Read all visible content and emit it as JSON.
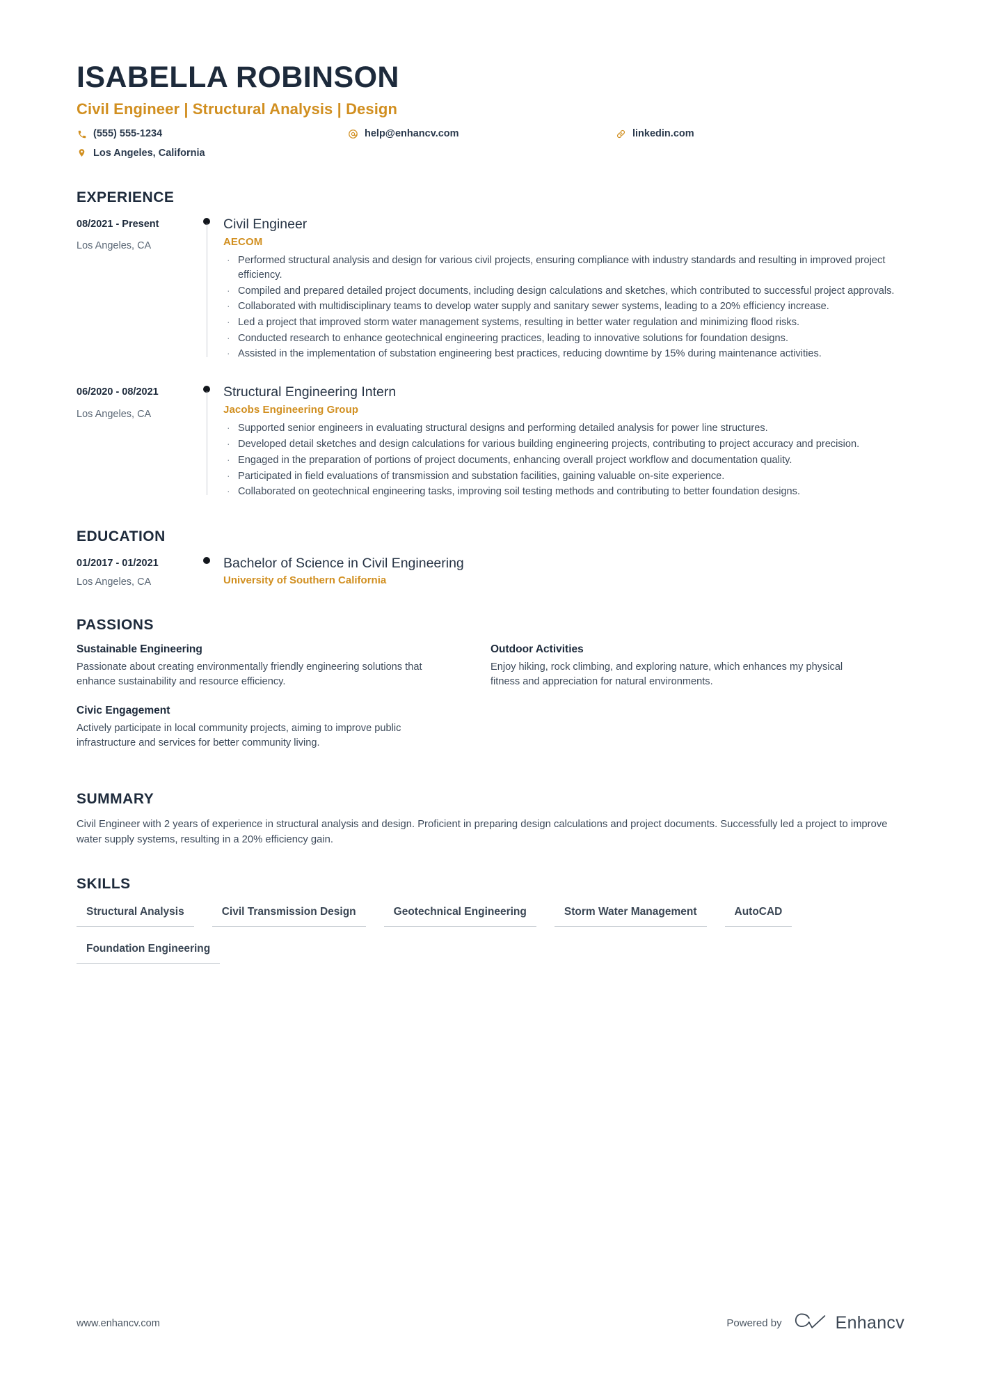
{
  "header": {
    "name": "ISABELLA ROBINSON",
    "headline": "Civil Engineer | Structural Analysis | Design",
    "contacts": [
      {
        "icon": "phone-icon",
        "text": "(555) 555-1234"
      },
      {
        "icon": "location-icon",
        "text": "Los Angeles, California"
      },
      {
        "icon": "email-icon",
        "text": "help@enhancv.com"
      },
      {
        "icon": "link-icon",
        "text": "linkedin.com"
      }
    ]
  },
  "experience": {
    "title": "EXPERIENCE",
    "entries": [
      {
        "date": "08/2021 - Present",
        "location": "Los Angeles, CA",
        "role": "Civil Engineer",
        "company": "AECOM",
        "bullets": [
          "Performed structural analysis and design for various civil projects, ensuring compliance with industry standards and resulting in improved project efficiency.",
          "Compiled and prepared detailed project documents, including design calculations and sketches, which contributed to successful project approvals.",
          "Collaborated with multidisciplinary teams to develop water supply and sanitary sewer systems, leading to a 20% efficiency increase.",
          "Led a project that improved storm water management systems, resulting in better water regulation and minimizing flood risks.",
          "Conducted research to enhance geotechnical engineering practices, leading to innovative solutions for foundation designs.",
          "Assisted in the implementation of substation engineering best practices, reducing downtime by 15% during maintenance activities."
        ]
      },
      {
        "date": "06/2020 - 08/2021",
        "location": "Los Angeles, CA",
        "role": "Structural Engineering Intern",
        "company": "Jacobs Engineering Group",
        "bullets": [
          "Supported senior engineers in evaluating structural designs and performing detailed analysis for power line structures.",
          "Developed detail sketches and design calculations for various building engineering projects, contributing to project accuracy and precision.",
          "Engaged in the preparation of portions of project documents, enhancing overall project workflow and documentation quality.",
          "Participated in field evaluations of transmission and substation facilities, gaining valuable on-site experience.",
          "Collaborated on geotechnical engineering tasks, improving soil testing methods and contributing to better foundation designs."
        ]
      }
    ]
  },
  "education": {
    "title": "EDUCATION",
    "entries": [
      {
        "date": "01/2017 - 01/2021",
        "location": "Los Angeles, CA",
        "degree": "Bachelor of Science in Civil Engineering",
        "school": "University of Southern California"
      }
    ]
  },
  "passions": {
    "title": "PASSIONS",
    "items": [
      {
        "name": "Sustainable Engineering",
        "text": "Passionate about creating environmentally friendly engineering solutions that enhance sustainability and resource efficiency."
      },
      {
        "name": "Outdoor Activities",
        "text": "Enjoy hiking, rock climbing, and exploring nature, which enhances my physical fitness and appreciation for natural environments."
      },
      {
        "name": "Civic Engagement",
        "text": "Actively participate in local community projects, aiming to improve public infrastructure and services for better community living."
      }
    ]
  },
  "summary": {
    "title": "SUMMARY",
    "text": "Civil Engineer with 2 years of experience in structural analysis and design. Proficient in preparing design calculations and project documents. Successfully led a project to improve water supply systems, resulting in a 20% efficiency gain."
  },
  "skills": {
    "title": "SKILLS",
    "items": [
      "Structural Analysis",
      "Civil Transmission Design",
      "Geotechnical Engineering",
      "Storm Water Management",
      "AutoCAD",
      "Foundation Engineering"
    ]
  },
  "footer": {
    "url": "www.enhancv.com",
    "powered_by": "Powered by",
    "brand": "Enhancv"
  },
  "colors": {
    "accent": "#d18f20",
    "heading": "#1d2a3b",
    "body": "#3d4a5a",
    "muted": "#5a6775",
    "rule": "#c2c8cf"
  }
}
